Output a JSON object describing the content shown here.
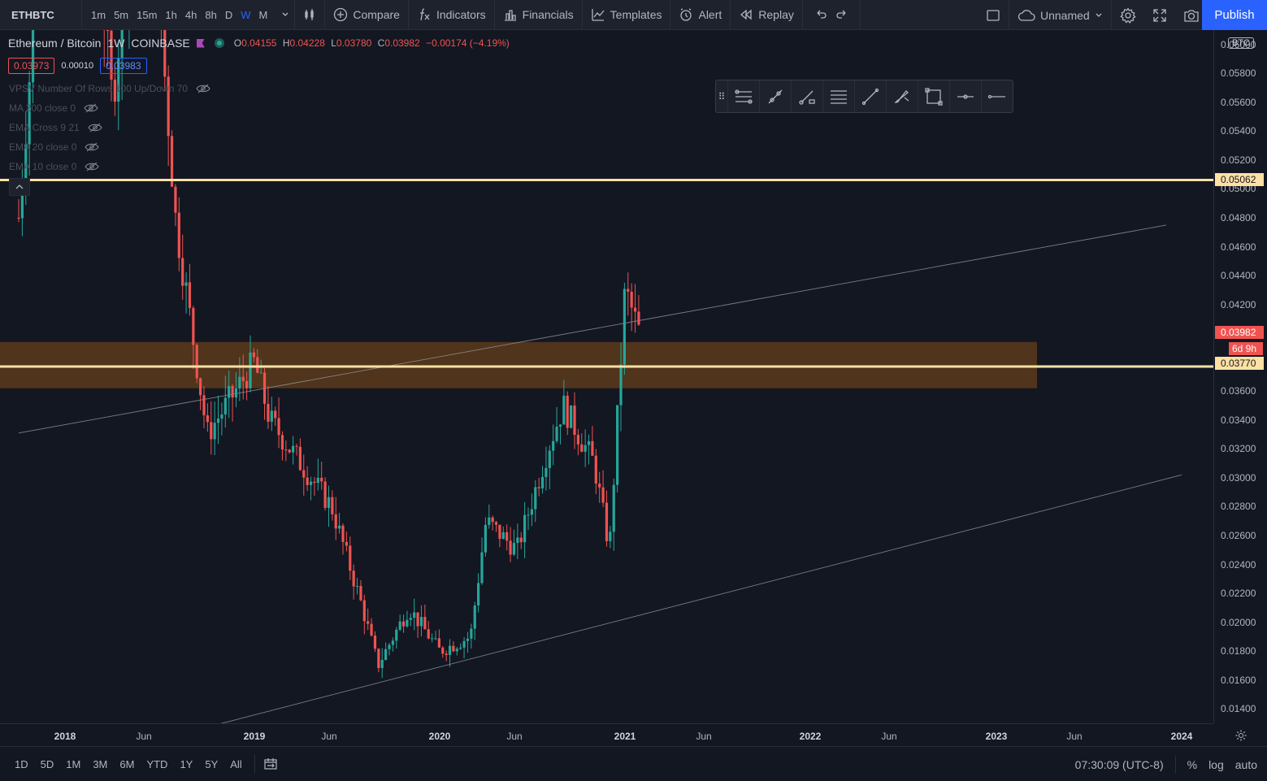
{
  "toolbar": {
    "symbol": "ETHBTC",
    "intervals": [
      "1m",
      "5m",
      "15m",
      "1h",
      "4h",
      "8h",
      "D",
      "W",
      "M"
    ],
    "active_interval": "W",
    "compare": "Compare",
    "indicators": "Indicators",
    "financials": "Financials",
    "templates": "Templates",
    "alert": "Alert",
    "replay": "Replay",
    "layout_name": "Unnamed",
    "publish": "Publish"
  },
  "legend": {
    "title": "Ethereum / Bitcoin",
    "interval": "1W",
    "exchange": "COINBASE",
    "o_label": "O",
    "o": "0.04155",
    "h_label": "H",
    "h": "0.04228",
    "l_label": "L",
    "l": "0.03780",
    "c_label": "C",
    "c": "0.03982",
    "change": "−0.00174 (−4.19%)",
    "bid": "0.03973",
    "spread": "0.00010",
    "ask": "0.03983"
  },
  "indicators": [
    "VPSV Number Of Rows 100 Up/Down 70",
    "MA 200 close 0",
    "EMA Cross 9 21",
    "EMA 20 close 0",
    "EMA 10 close 0"
  ],
  "price_axis": {
    "currency": "BTC",
    "ticks": [
      "0.06000",
      "0.05800",
      "0.05600",
      "0.05400",
      "0.05200",
      "0.05000",
      "0.04800",
      "0.04600",
      "0.04400",
      "0.04200",
      "0.04000",
      "0.03800",
      "0.03600",
      "0.03400",
      "0.03200",
      "0.03000",
      "0.02800",
      "0.02600",
      "0.02400",
      "0.02200",
      "0.02000",
      "0.01800",
      "0.01600",
      "0.01400"
    ],
    "level_upper": "0.05062",
    "last_price": "0.03982",
    "countdown": "6d 9h",
    "level_lower": "0.03770"
  },
  "time_axis": [
    "2018",
    "Jun",
    "2019",
    "Jun",
    "2020",
    "Jun",
    "2021",
    "Jun",
    "2022",
    "Jun",
    "2023",
    "Jun",
    "2024"
  ],
  "bottom": {
    "ranges": [
      "1D",
      "5D",
      "1M",
      "3M",
      "6M",
      "YTD",
      "1Y",
      "5Y",
      "All"
    ],
    "clock": "07:30:09 (UTC-8)",
    "percent": "%",
    "log": "log",
    "auto": "auto"
  },
  "colors": {
    "up": "#26a69a",
    "down": "#ef5350",
    "level_line": "#ffe0a3",
    "zone": "#5c3a1a",
    "accent": "#2962ff"
  },
  "chart_data": {
    "type": "candlestick",
    "title": "Ethereum / Bitcoin",
    "interval": "1W",
    "y_range": [
      0.013,
      0.061
    ],
    "horizontal_levels": [
      0.05062,
      0.0377
    ],
    "zone": [
      0.0362,
      0.0394
    ],
    "trendlines": [
      {
        "from": [
          "2017-10",
          0.0331
        ],
        "to": [
          "2023-12",
          0.0475
        ]
      },
      {
        "from": [
          "2018-06",
          0.0116
        ],
        "to": [
          "2024-01",
          0.0302
        ]
      }
    ],
    "approx_close_path": [
      [
        "2017-10",
        0.048
      ],
      [
        "2018-01",
        0.09
      ],
      [
        "2018-04",
        0.056
      ],
      [
        "2018-06",
        0.077
      ],
      [
        "2018-08",
        0.048
      ],
      [
        "2018-10",
        0.033
      ],
      [
        "2019-01",
        0.038
      ],
      [
        "2019-02",
        0.034
      ],
      [
        "2019-04",
        0.031
      ],
      [
        "2019-06",
        0.028
      ],
      [
        "2019-08",
        0.021
      ],
      [
        "2019-09",
        0.017
      ],
      [
        "2019-11",
        0.021
      ],
      [
        "2020-01",
        0.018
      ],
      [
        "2020-03",
        0.019
      ],
      [
        "2020-04",
        0.027
      ],
      [
        "2020-06",
        0.025
      ],
      [
        "2020-08",
        0.032
      ],
      [
        "2020-09",
        0.035
      ],
      [
        "2020-11",
        0.031
      ],
      [
        "2020-12",
        0.025
      ],
      [
        "2021-01",
        0.043
      ],
      [
        "2021-02",
        0.0398
      ]
    ]
  }
}
